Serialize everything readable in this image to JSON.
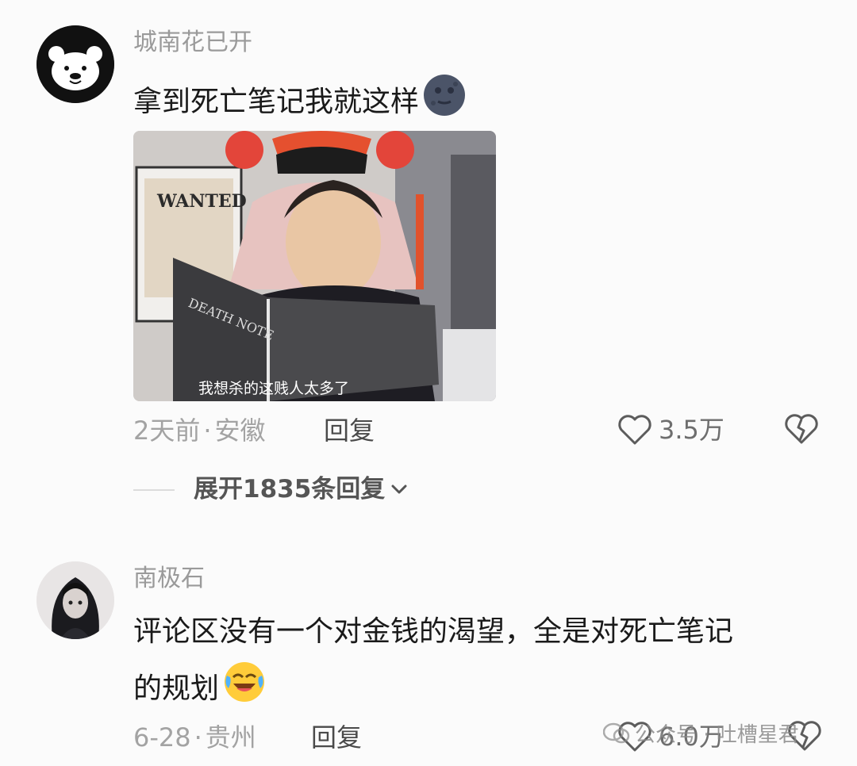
{
  "comments": [
    {
      "username": "城南花已开",
      "text": "拿到死亡笔记我就这样",
      "emoji": "full-moon-face-emoji",
      "media": {
        "poster_text": "WANTED",
        "book_text": "DEATH NOTE",
        "caption": "我想杀的这贱人太多了"
      },
      "time": "2天前",
      "separator": "·",
      "location": "安徽",
      "reply_label": "回复",
      "likes": "3.5万",
      "expand_label": "展开1835条回复"
    },
    {
      "username": "南极石",
      "text_line1": "评论区没有一个对金钱的渴望，全是对死亡笔记",
      "text_line2": "的规划",
      "emoji": "rolling-laughing-emoji",
      "time": "6-28",
      "separator": "·",
      "location": "贵州",
      "reply_label": "回复",
      "likes": "6.0万"
    }
  ],
  "watermark": "公众号 · 吐槽星君",
  "icons": {
    "like": "heart-outline-icon",
    "dislike": "broken-heart-icon",
    "expand": "chevron-down-icon"
  },
  "colors": {
    "meta": "#a3a3a3",
    "text": "#1a1a1a",
    "accent": "#4a4a4a"
  }
}
